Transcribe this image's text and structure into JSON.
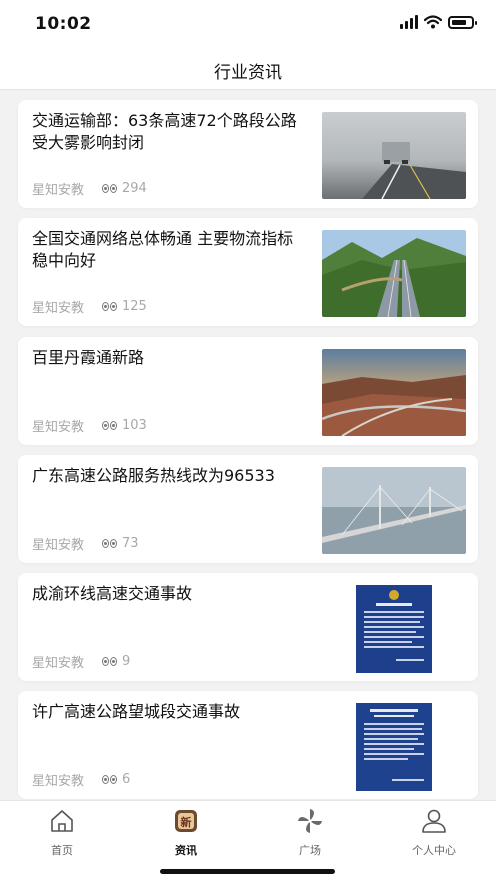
{
  "status": {
    "time": "10:02"
  },
  "header": {
    "title": "行业资讯"
  },
  "articles": [
    {
      "title": "交通运输部：63条高速72个路段公路受大雾影响封闭",
      "source": "星知安教",
      "views": "294",
      "thumb": "foggy-highway-truck"
    },
    {
      "title": "全国交通网络总体畅通 主要物流指标稳中向好",
      "source": "星知安教",
      "views": "125",
      "thumb": "mountain-expressway"
    },
    {
      "title": "百里丹霞通新路",
      "source": "星知安教",
      "views": "103",
      "thumb": "red-canyon-road"
    },
    {
      "title": "广东高速公路服务热线改为96533",
      "source": "星知安教",
      "views": "73",
      "thumb": "cable-stayed-bridge"
    },
    {
      "title": "成渝环线高速交通事故",
      "source": "星知安教",
      "views": "9",
      "thumb": "police-notice-document"
    },
    {
      "title": "许广高速公路望城段交通事故",
      "source": "星知安教",
      "views": "6",
      "thumb": "police-notice-document"
    }
  ],
  "tabs": [
    {
      "label": "首页",
      "icon": "home-icon"
    },
    {
      "label": "资讯",
      "icon": "news-icon",
      "active": true
    },
    {
      "label": "广场",
      "icon": "pinwheel-icon"
    },
    {
      "label": "个人中心",
      "icon": "user-icon"
    }
  ],
  "colors": {
    "accent": "#b5651d",
    "background": "#f2f2f2"
  }
}
